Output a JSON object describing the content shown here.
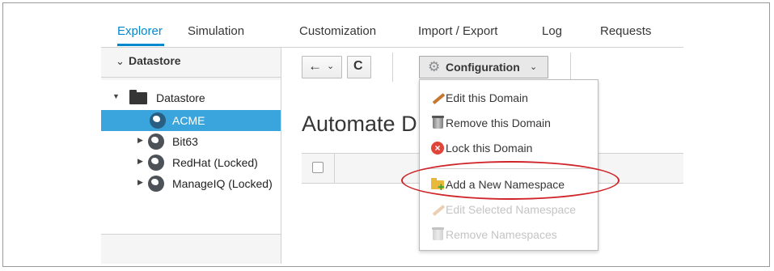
{
  "tabs": [
    "Explorer",
    "Simulation",
    "Customization",
    "Import / Export",
    "Log",
    "Requests"
  ],
  "accordion": {
    "title": "Datastore"
  },
  "tree": {
    "root": "Datastore",
    "nodes": [
      {
        "label": "ACME",
        "selected": true
      },
      {
        "label": "Bit63",
        "selected": false
      },
      {
        "label": "RedHat (Locked)",
        "selected": false
      },
      {
        "label": "ManageIQ (Locked)",
        "selected": false
      }
    ]
  },
  "toolbar": {
    "back_icon": "←",
    "reload_icon": "C",
    "config_label": "Configuration",
    "dropdown_caret": "⌄"
  },
  "page_title": "Automate D",
  "menu": {
    "items": [
      {
        "label": "Edit this Domain",
        "icon": "pencil-icon",
        "enabled": true
      },
      {
        "label": "Remove this Domain",
        "icon": "trash-icon",
        "enabled": true
      },
      {
        "label": "Lock this Domain",
        "icon": "lock-x-icon",
        "enabled": true
      },
      {
        "label": "Add a New Namespace",
        "icon": "folder-add-icon",
        "enabled": true
      },
      {
        "label": "Edit Selected Namespace",
        "icon": "pencil-icon",
        "enabled": false
      },
      {
        "label": "Remove Namespaces",
        "icon": "trash-icon",
        "enabled": false
      }
    ]
  },
  "colors": {
    "accent": "#0088ce",
    "selected_row": "#39a5dc",
    "highlight_ellipse": "#d0242b"
  }
}
